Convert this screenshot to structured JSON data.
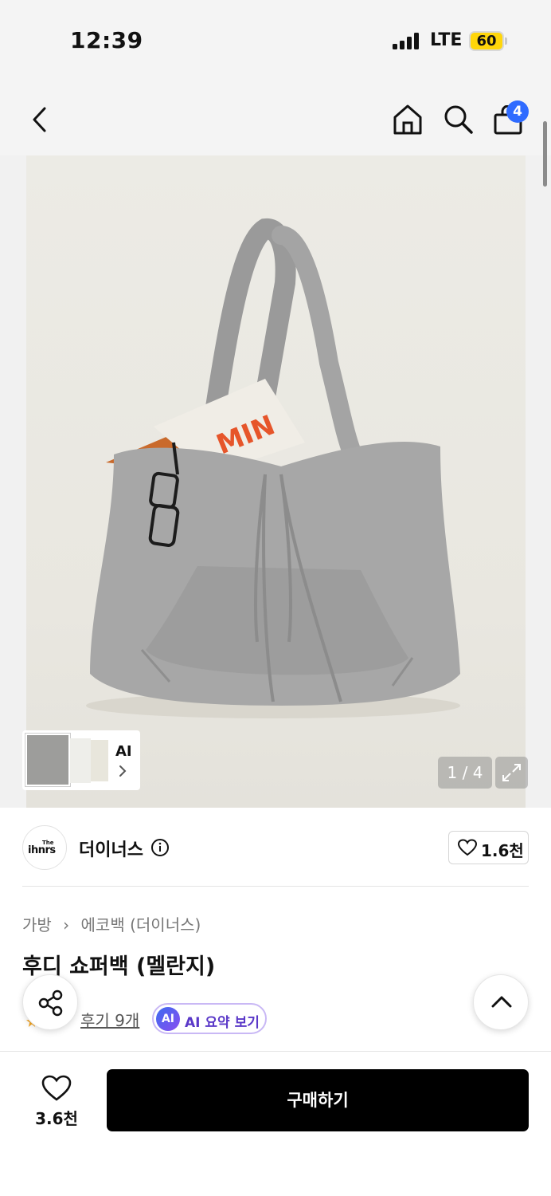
{
  "status_bar": {
    "time": "12:39",
    "network": "LTE",
    "battery": "60",
    "battery_color": "#ffd60a"
  },
  "navbar": {
    "back_icon": "chevron-left-icon",
    "home_icon": "home-icon",
    "search_icon": "search-icon",
    "cart_icon": "shopping-bag-icon",
    "cart_count": "4",
    "badge_color": "#2f6bff"
  },
  "gallery": {
    "image_alt": "후디 쇼퍼백 (멜란지)",
    "thumbnail_label": "AI",
    "page_counter": "1 / 4",
    "expand_icon": "expand-icon"
  },
  "brand": {
    "logo_line1": "The",
    "logo_line2": "ihnrs",
    "name": "더이너스",
    "likes": "1.6천"
  },
  "product": {
    "breadcrumb": [
      "가방",
      "에코백 (더이너스)"
    ],
    "title": "후디 쇼퍼백 (멜란지)",
    "reviews_label": "후기 9개",
    "ai_badge": "AI",
    "ai_summary_label": "AI 요약 보기"
  },
  "floating": {
    "share_icon": "share-icon",
    "top_icon": "chevron-up-icon"
  },
  "bottom_bar": {
    "wish_count": "3.6천",
    "buy_label": "구매하기"
  }
}
